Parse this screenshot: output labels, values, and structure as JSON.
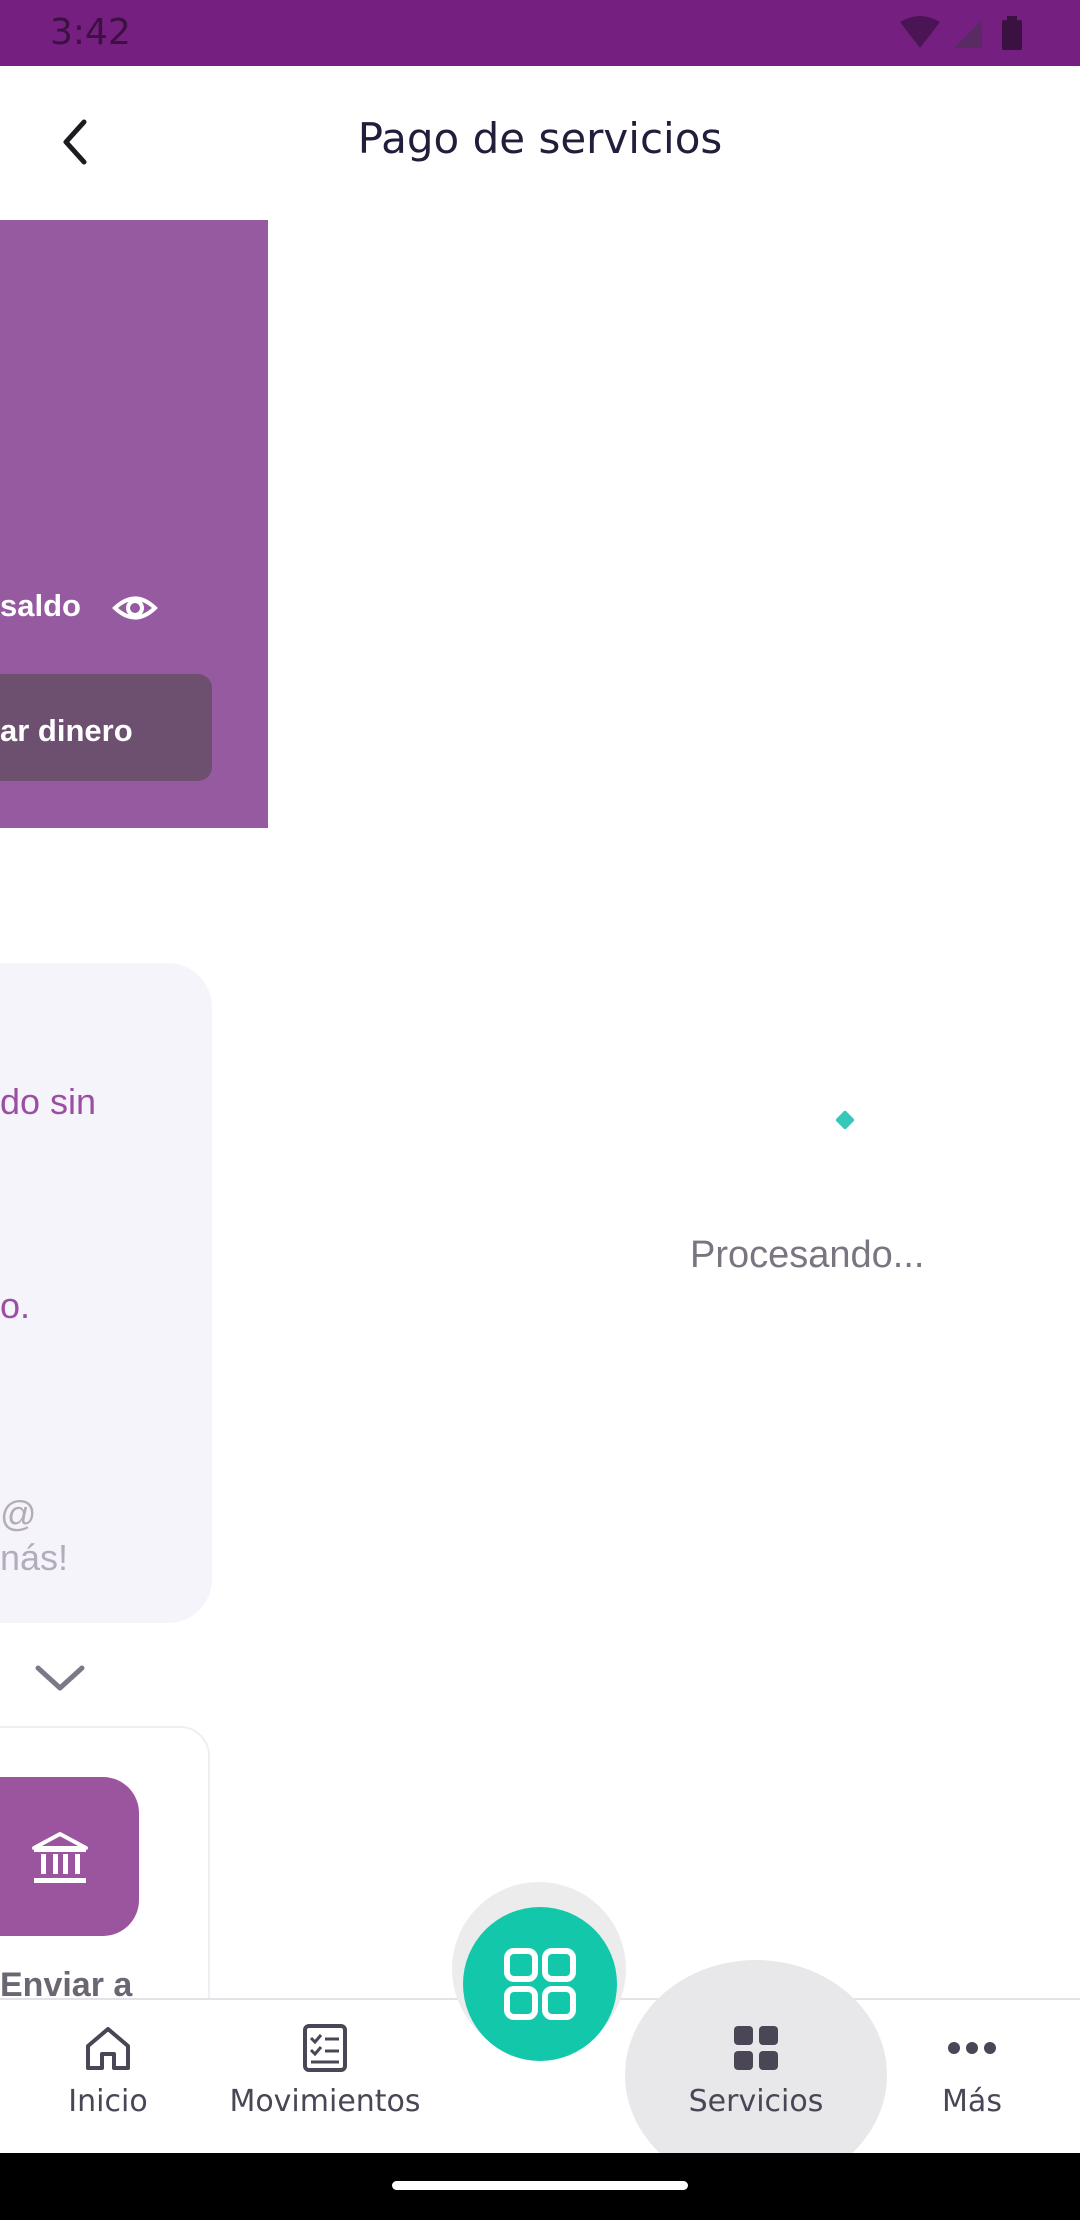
{
  "status_bar": {
    "time": "3:42",
    "icons": [
      "wifi-icon",
      "signal-icon",
      "battery-icon"
    ]
  },
  "app_bar": {
    "title": "Pago de servicios",
    "back_icon": "back-arrow-icon"
  },
  "balance_card": {
    "show_balance_label": "saldo",
    "action_button_label": "ar dinero",
    "colors": {
      "card": "#955a9f",
      "button": "#6d4f6f"
    }
  },
  "promo_card": {
    "lines": [
      "do sin",
      "o.",
      "@",
      "nás!"
    ]
  },
  "quick_actions": {
    "send_label": "Enviar a"
  },
  "loading": {
    "message": "Procesando..."
  },
  "bottom_nav": {
    "items": [
      {
        "label": "Inicio",
        "icon": "home-icon"
      },
      {
        "label": "Movimientos",
        "icon": "checklist-icon"
      },
      {
        "label": "Servicios",
        "icon": "grid-icon",
        "active": true
      },
      {
        "label": "Más",
        "icon": "more-icon"
      }
    ],
    "fab_icon": "qr-grid-icon",
    "fab_color": "#13c7ab"
  },
  "colors": {
    "status_bar": "#751f80",
    "accent": "#13c7ab",
    "spinner": "#35c7b7"
  }
}
